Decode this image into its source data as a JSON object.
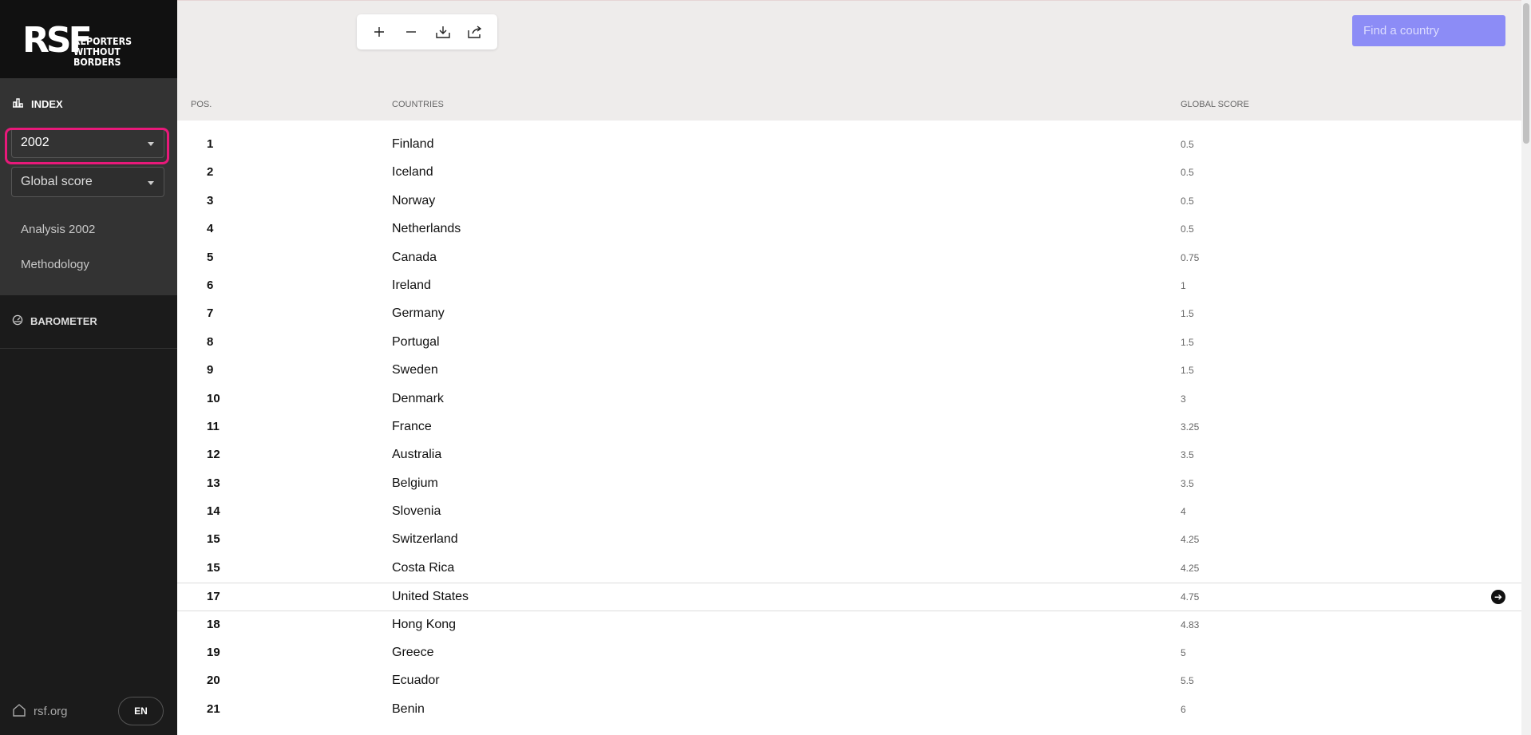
{
  "sidebar": {
    "logo_mark": "RSF",
    "logo_line1": "Reporters",
    "logo_line2": "without borders",
    "nav_index": "INDEX",
    "year_select": "2002",
    "metric_select": "Global score",
    "links": [
      "Analysis 2002",
      "Methodology"
    ],
    "nav_barometer": "BAROMETER",
    "footer_home": "rsf.org",
    "language": "EN"
  },
  "toolbar": {
    "icons": [
      "plus-icon",
      "minus-icon",
      "download-icon",
      "share-icon"
    ]
  },
  "search": {
    "placeholder": "Find a country"
  },
  "table": {
    "headers": {
      "pos": "POS.",
      "country": "COUNTRIES",
      "score": "GLOBAL SCORE"
    },
    "rows": [
      {
        "pos": "1",
        "country": "Finland",
        "score": "0.5"
      },
      {
        "pos": "2",
        "country": "Iceland",
        "score": "0.5"
      },
      {
        "pos": "3",
        "country": "Norway",
        "score": "0.5"
      },
      {
        "pos": "4",
        "country": "Netherlands",
        "score": "0.5"
      },
      {
        "pos": "5",
        "country": "Canada",
        "score": "0.75"
      },
      {
        "pos": "6",
        "country": "Ireland",
        "score": "1"
      },
      {
        "pos": "7",
        "country": "Germany",
        "score": "1.5"
      },
      {
        "pos": "8",
        "country": "Portugal",
        "score": "1.5"
      },
      {
        "pos": "9",
        "country": "Sweden",
        "score": "1.5"
      },
      {
        "pos": "10",
        "country": "Denmark",
        "score": "3"
      },
      {
        "pos": "11",
        "country": "France",
        "score": "3.25"
      },
      {
        "pos": "12",
        "country": "Australia",
        "score": "3.5"
      },
      {
        "pos": "13",
        "country": "Belgium",
        "score": "3.5"
      },
      {
        "pos": "14",
        "country": "Slovenia",
        "score": "4"
      },
      {
        "pos": "15",
        "country": "Switzerland",
        "score": "4.25"
      },
      {
        "pos": "15",
        "country": "Costa Rica",
        "score": "4.25"
      },
      {
        "pos": "17",
        "country": "United States",
        "score": "4.75",
        "highlighted": true
      },
      {
        "pos": "18",
        "country": "Hong Kong",
        "score": "4.83"
      },
      {
        "pos": "19",
        "country": "Greece",
        "score": "5"
      },
      {
        "pos": "20",
        "country": "Ecuador",
        "score": "5.5"
      },
      {
        "pos": "21",
        "country": "Benin",
        "score": "6"
      }
    ]
  },
  "colors": {
    "sidebar_bg": "#1b1b1b",
    "sidebar_section_bg": "#333333",
    "highlight_border": "#e8197a",
    "search_bg": "#8c8cf6",
    "header_bg": "#eeeceb"
  }
}
